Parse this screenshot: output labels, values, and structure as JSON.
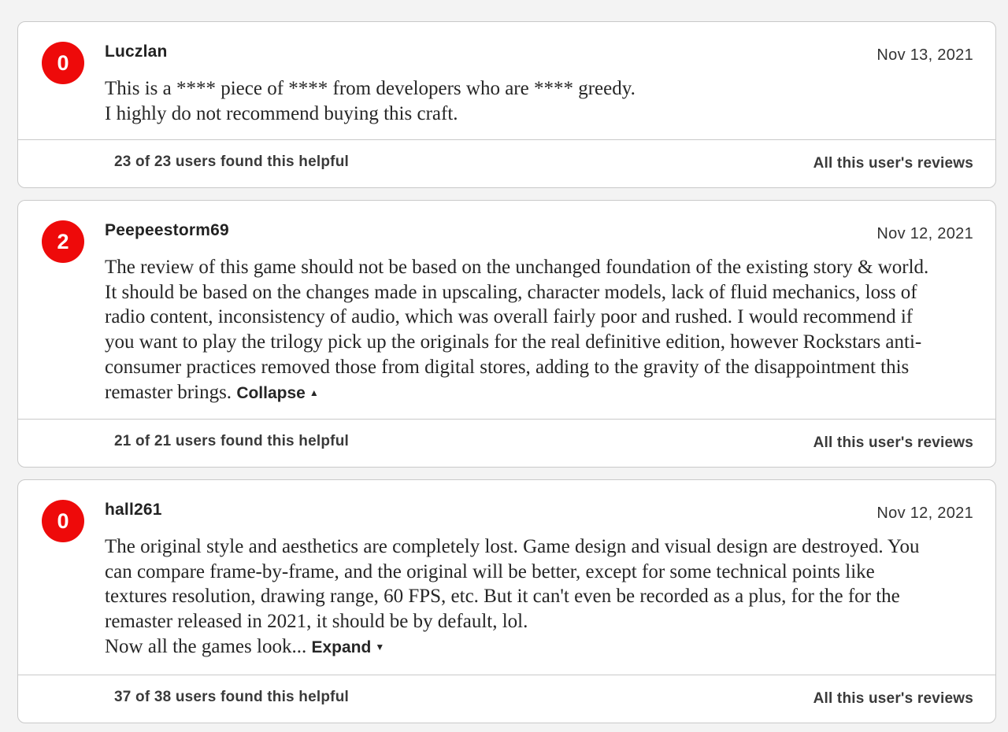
{
  "colors": {
    "score_badge": "#ee0a0a",
    "card_background": "#ffffff",
    "page_background": "#f3f3f3",
    "border": "#c9c9c9"
  },
  "reviews": [
    {
      "score": "0",
      "username": "Luczlan",
      "date": "Nov 13, 2021",
      "lines": [
        "This is a **** piece of **** from developers who are **** greedy.",
        "I highly do not recommend buying this craft."
      ],
      "toggle_label": "",
      "toggle_icon": "",
      "helpful": "23 of 23 users found this helpful",
      "all_reviews_label": "All this user's reviews"
    },
    {
      "score": "2",
      "username": "Peepeestorm69",
      "date": "Nov 12, 2021",
      "lines": [
        "The review of this game should not be based on the unchanged foundation of the existing story & world.",
        "It should be based on the changes made in upscaling, character models, lack of fluid mechanics, loss of",
        "radio content, inconsistency of audio, which was overall fairly poor and rushed. I would recommend if",
        "you want to play the trilogy pick up the originals for the real definitive edition, however Rockstars anti-",
        "consumer practices removed those from digital stores, adding to the gravity of the disappointment this",
        "remaster brings. "
      ],
      "toggle_label": "Collapse",
      "toggle_icon": "▲",
      "helpful": "21 of 21 users found this helpful",
      "all_reviews_label": "All this user's reviews"
    },
    {
      "score": "0",
      "username": "hall261",
      "date": "Nov 12, 2021",
      "lines": [
        "The original style and aesthetics are completely lost. Game design and visual design are destroyed. You",
        "can compare frame-by-frame, and the original will be better, except for some technical points like",
        "textures resolution, drawing range, 60 FPS, etc. But it can't even be recorded as a plus, for the for the",
        "remaster released in 2021, it should be by default, lol.",
        "Now all the games look... "
      ],
      "toggle_label": "Expand",
      "toggle_icon": "▼",
      "helpful": "37 of 38 users found this helpful",
      "all_reviews_label": "All this user's reviews"
    }
  ]
}
